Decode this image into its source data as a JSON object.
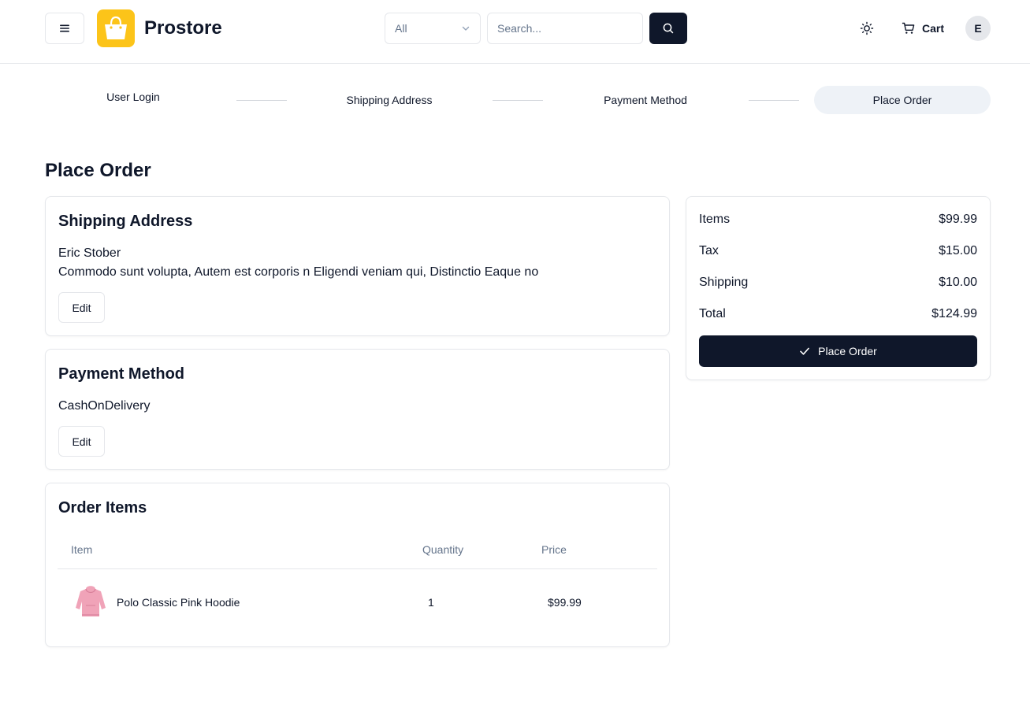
{
  "header": {
    "brand": "Prostore",
    "category_select": "All",
    "search_placeholder": "Search...",
    "cart_label": "Cart",
    "avatar_initial": "E"
  },
  "stepper": {
    "steps": [
      "User Login",
      "Shipping Address",
      "Payment Method",
      "Place Order"
    ],
    "active_index": 3
  },
  "page": {
    "title": "Place Order"
  },
  "shipping": {
    "title": "Shipping Address",
    "name": "Eric Stober",
    "address": "Commodo sunt volupta, Autem est corporis n Eligendi veniam qui, Distinctio Eaque no",
    "edit_label": "Edit"
  },
  "payment": {
    "title": "Payment Method",
    "method": "CashOnDelivery",
    "edit_label": "Edit"
  },
  "order_items": {
    "title": "Order Items",
    "columns": [
      "Item",
      "Quantity",
      "Price"
    ],
    "rows": [
      {
        "name": "Polo Classic Pink Hoodie",
        "quantity": "1",
        "price": "$99.99"
      }
    ]
  },
  "summary": {
    "rows": [
      {
        "label": "Items",
        "value": "$99.99"
      },
      {
        "label": "Tax",
        "value": "$15.00"
      },
      {
        "label": "Shipping",
        "value": "$10.00"
      },
      {
        "label": "Total",
        "value": "$124.99"
      }
    ],
    "place_order_label": "Place Order"
  },
  "colors": {
    "brand_yellow": "#fcc419",
    "primary_dark": "#0f172a",
    "border": "#e5e7eb",
    "muted_text": "#64748b",
    "active_step_bg": "#eef2f7",
    "hoodie_pink": "#f0a3b8"
  },
  "icons": {
    "menu": "hamburger-icon",
    "logo": "shopping-bag-icon",
    "select": "chevron-down-icon",
    "search": "search-icon",
    "theme": "sun-icon",
    "cart": "cart-icon",
    "place_order": "check-icon"
  }
}
